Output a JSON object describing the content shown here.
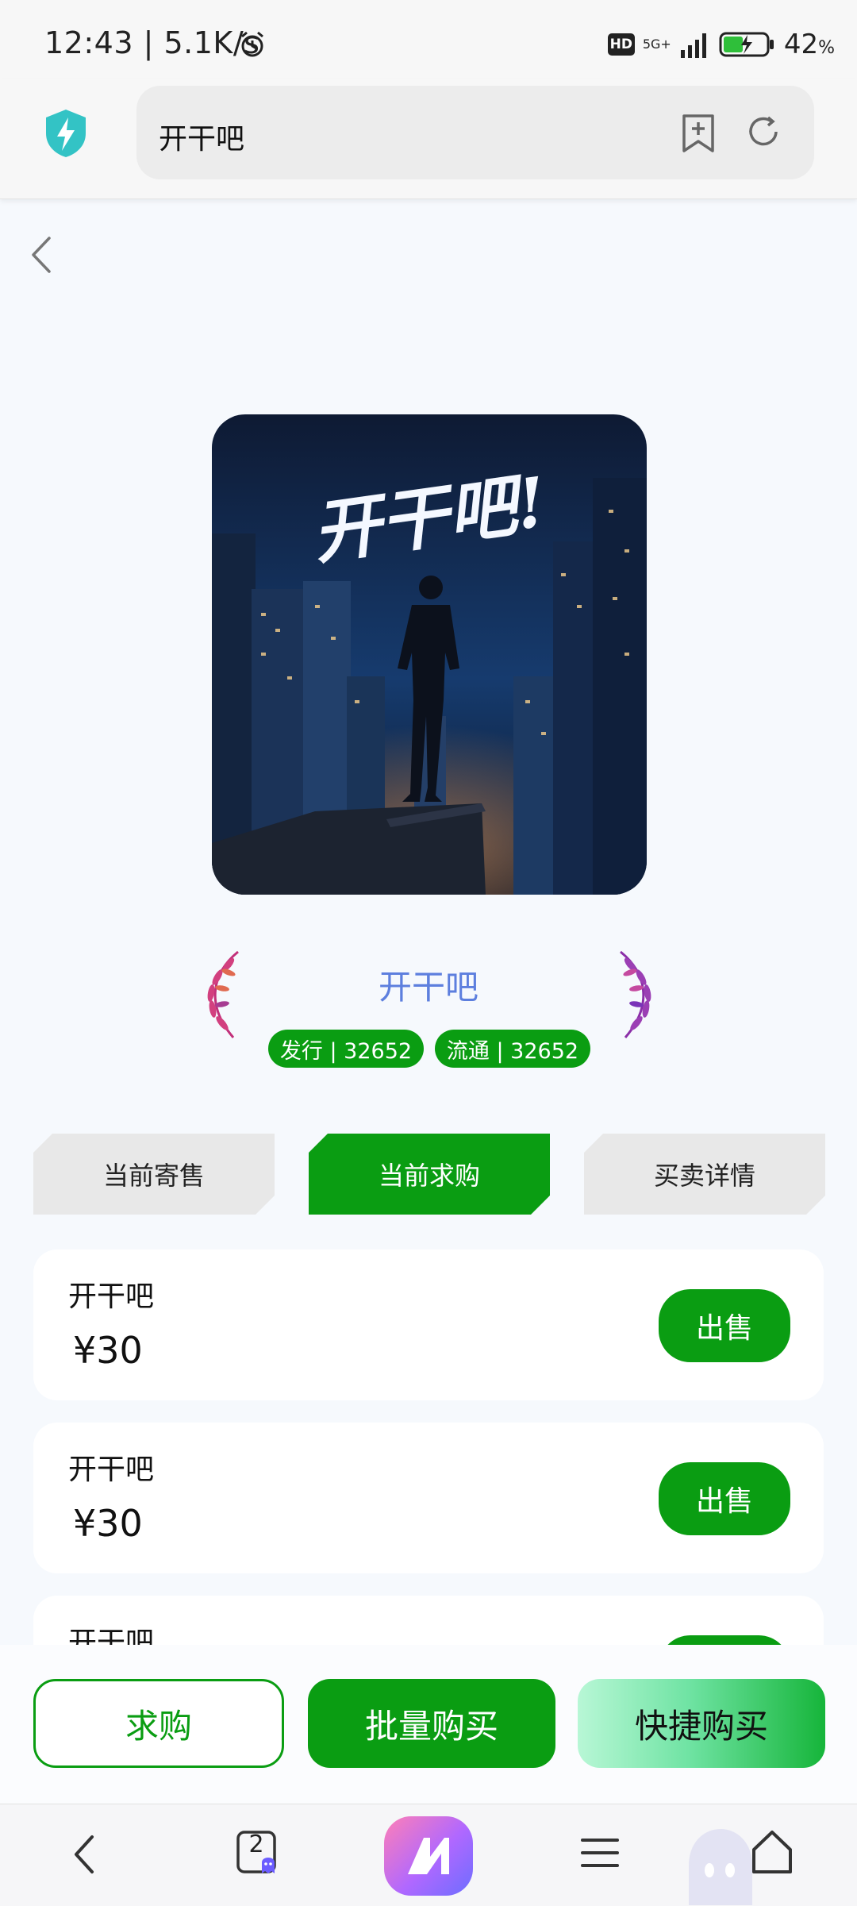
{
  "status_bar": {
    "time": "12:43 | 5.1K/s",
    "hd": "HD",
    "network": "5G+",
    "battery": "42",
    "battery_unit": "%"
  },
  "browser": {
    "url_text": "开干吧"
  },
  "item": {
    "cover_text": "开干吧!",
    "title": "开干吧",
    "issue_badge": "发行 | 32652",
    "circulation_badge": "流通 | 32652"
  },
  "tabs": [
    {
      "label": "当前寄售",
      "active": false
    },
    {
      "label": "当前求购",
      "active": true
    },
    {
      "label": "买卖详情",
      "active": false
    }
  ],
  "listings": [
    {
      "name": "开干吧",
      "price": "¥30",
      "action": "出售"
    },
    {
      "name": "开干吧",
      "price": "¥30",
      "action": "出售"
    },
    {
      "name": "开干吧",
      "price": "",
      "action": ""
    }
  ],
  "actions": {
    "want_to_buy": "求购",
    "bulk_buy": "批量购买",
    "quick_buy": "快捷购买"
  },
  "nav": {
    "tab_count": "2"
  },
  "colors": {
    "primary_green": "#0a9d12",
    "title_blue": "#5d7fde"
  }
}
